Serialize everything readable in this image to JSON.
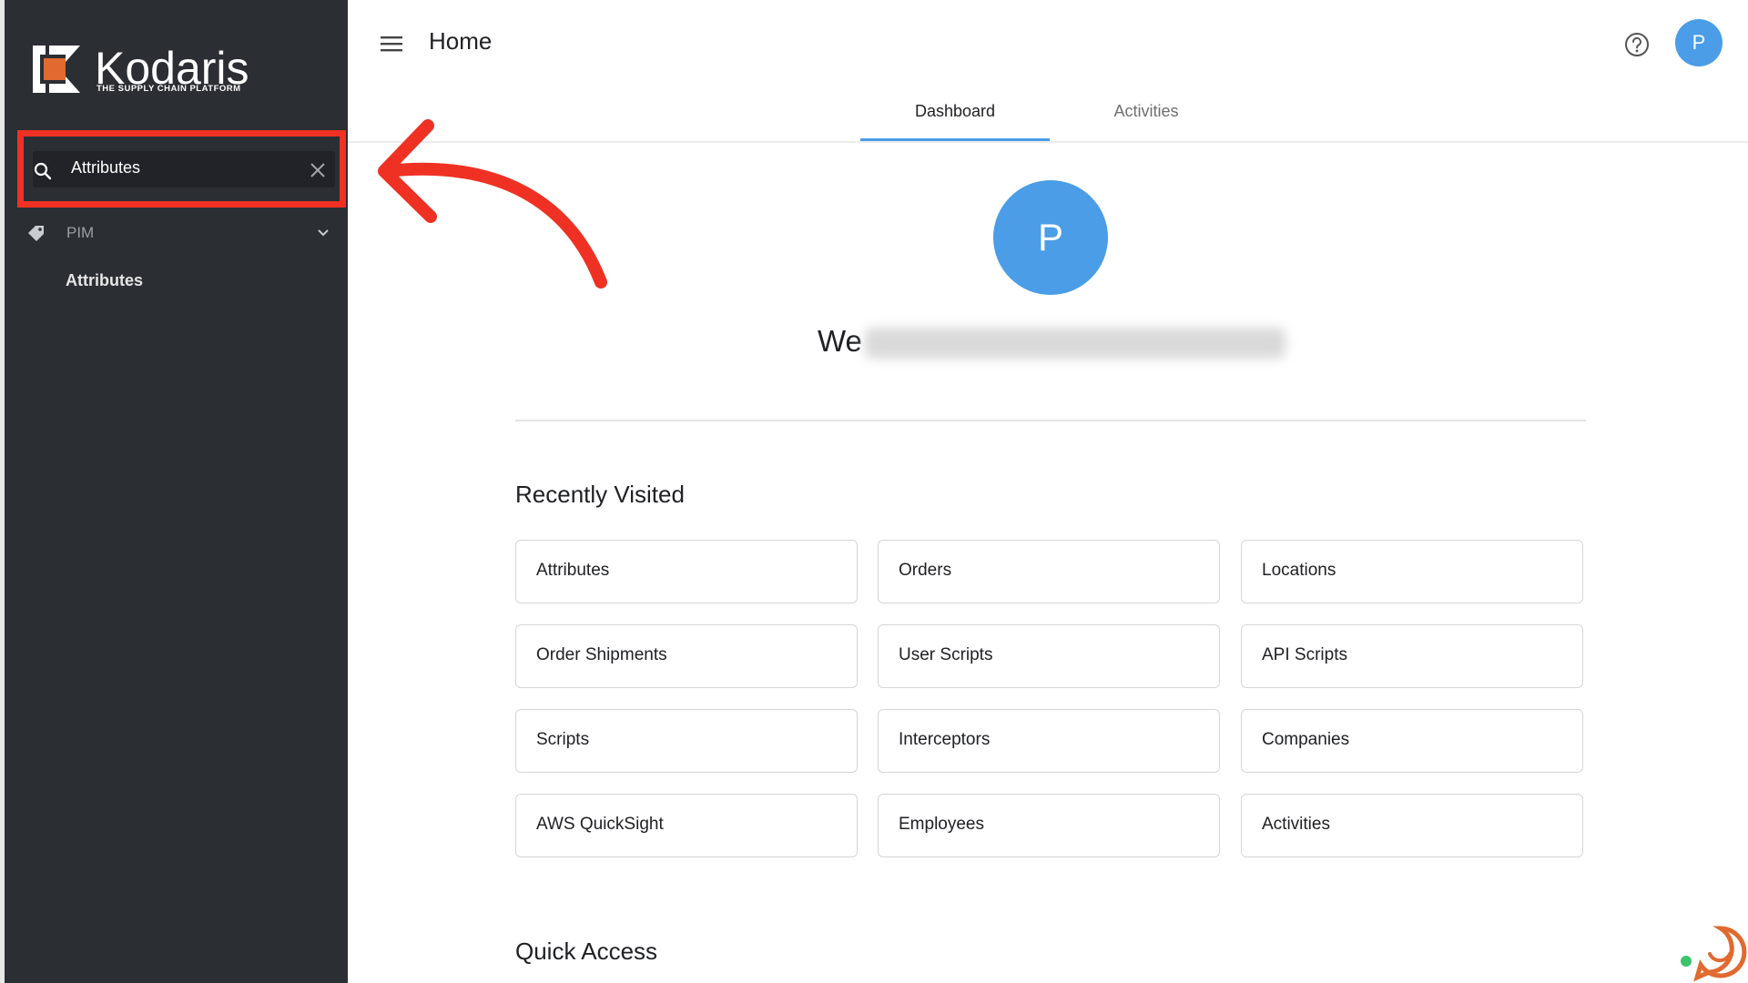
{
  "brand": {
    "name": "Kodaris",
    "tagline": "THE SUPPLY CHAIN PLATFORM",
    "accent": "#e06a30"
  },
  "sidebar": {
    "search": {
      "value": "Attributes",
      "placeholder": ""
    },
    "nav": {
      "group_label": "PIM",
      "child_label": "Attributes"
    }
  },
  "header": {
    "title": "Home",
    "avatar_initial": "P"
  },
  "tabs": [
    {
      "label": "Dashboard",
      "active": true
    },
    {
      "label": "Activities",
      "active": false
    }
  ],
  "welcome": {
    "avatar_initial": "P",
    "prefix": "We"
  },
  "recently_visited": {
    "title": "Recently Visited",
    "items": [
      "Attributes",
      "Orders",
      "Locations",
      "Order Shipments",
      "User Scripts",
      "API Scripts",
      "Scripts",
      "Interceptors",
      "Companies",
      "AWS QuickSight",
      "Employees",
      "Activities"
    ]
  },
  "quick_access": {
    "title": "Quick Access"
  },
  "colors": {
    "sidebar_bg": "#2b2e33",
    "primary": "#4a9de6",
    "highlight": "#ef3124"
  }
}
